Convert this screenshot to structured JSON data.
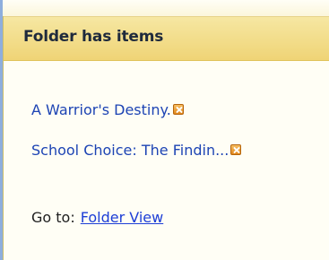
{
  "panel": {
    "title": "Folder has items",
    "items": [
      {
        "label": "A Warrior's Destiny.",
        "remove_icon": "remove-icon"
      },
      {
        "label": "School Choice: The Findin...",
        "remove_icon": "remove-icon"
      }
    ],
    "goto_label": "Go to:",
    "goto_link": "Folder View"
  },
  "colors": {
    "header_bg": "#efd476",
    "panel_bg": "#fffef5",
    "link": "#1d44b4",
    "left_border": "#8eaedd",
    "icon_orange": "#e0861b"
  }
}
